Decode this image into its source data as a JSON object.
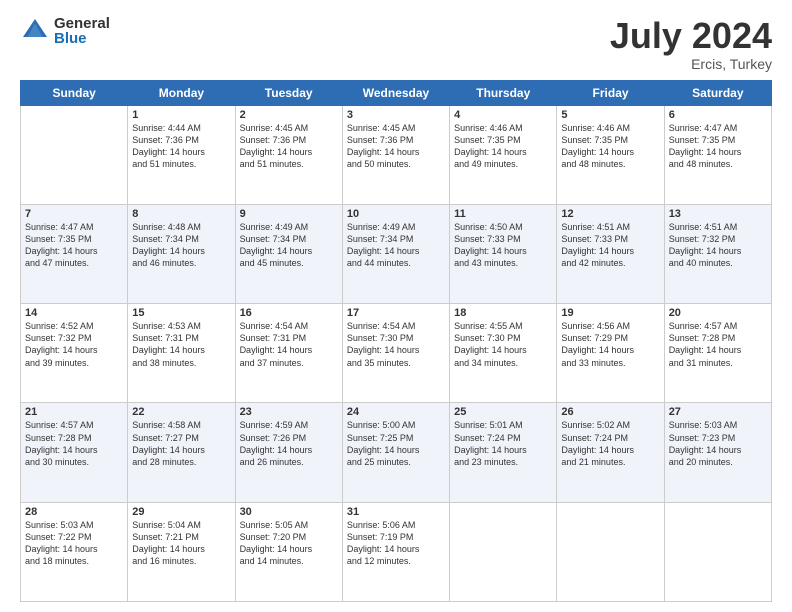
{
  "logo": {
    "general": "General",
    "blue": "Blue"
  },
  "title": "July 2024",
  "subtitle": "Ercis, Turkey",
  "days_of_week": [
    "Sunday",
    "Monday",
    "Tuesday",
    "Wednesday",
    "Thursday",
    "Friday",
    "Saturday"
  ],
  "weeks": [
    [
      {
        "day": "",
        "info": ""
      },
      {
        "day": "1",
        "info": "Sunrise: 4:44 AM\nSunset: 7:36 PM\nDaylight: 14 hours\nand 51 minutes."
      },
      {
        "day": "2",
        "info": "Sunrise: 4:45 AM\nSunset: 7:36 PM\nDaylight: 14 hours\nand 51 minutes."
      },
      {
        "day": "3",
        "info": "Sunrise: 4:45 AM\nSunset: 7:36 PM\nDaylight: 14 hours\nand 50 minutes."
      },
      {
        "day": "4",
        "info": "Sunrise: 4:46 AM\nSunset: 7:35 PM\nDaylight: 14 hours\nand 49 minutes."
      },
      {
        "day": "5",
        "info": "Sunrise: 4:46 AM\nSunset: 7:35 PM\nDaylight: 14 hours\nand 48 minutes."
      },
      {
        "day": "6",
        "info": "Sunrise: 4:47 AM\nSunset: 7:35 PM\nDaylight: 14 hours\nand 48 minutes."
      }
    ],
    [
      {
        "day": "7",
        "info": "Sunrise: 4:47 AM\nSunset: 7:35 PM\nDaylight: 14 hours\nand 47 minutes."
      },
      {
        "day": "8",
        "info": "Sunrise: 4:48 AM\nSunset: 7:34 PM\nDaylight: 14 hours\nand 46 minutes."
      },
      {
        "day": "9",
        "info": "Sunrise: 4:49 AM\nSunset: 7:34 PM\nDaylight: 14 hours\nand 45 minutes."
      },
      {
        "day": "10",
        "info": "Sunrise: 4:49 AM\nSunset: 7:34 PM\nDaylight: 14 hours\nand 44 minutes."
      },
      {
        "day": "11",
        "info": "Sunrise: 4:50 AM\nSunset: 7:33 PM\nDaylight: 14 hours\nand 43 minutes."
      },
      {
        "day": "12",
        "info": "Sunrise: 4:51 AM\nSunset: 7:33 PM\nDaylight: 14 hours\nand 42 minutes."
      },
      {
        "day": "13",
        "info": "Sunrise: 4:51 AM\nSunset: 7:32 PM\nDaylight: 14 hours\nand 40 minutes."
      }
    ],
    [
      {
        "day": "14",
        "info": "Sunrise: 4:52 AM\nSunset: 7:32 PM\nDaylight: 14 hours\nand 39 minutes."
      },
      {
        "day": "15",
        "info": "Sunrise: 4:53 AM\nSunset: 7:31 PM\nDaylight: 14 hours\nand 38 minutes."
      },
      {
        "day": "16",
        "info": "Sunrise: 4:54 AM\nSunset: 7:31 PM\nDaylight: 14 hours\nand 37 minutes."
      },
      {
        "day": "17",
        "info": "Sunrise: 4:54 AM\nSunset: 7:30 PM\nDaylight: 14 hours\nand 35 minutes."
      },
      {
        "day": "18",
        "info": "Sunrise: 4:55 AM\nSunset: 7:30 PM\nDaylight: 14 hours\nand 34 minutes."
      },
      {
        "day": "19",
        "info": "Sunrise: 4:56 AM\nSunset: 7:29 PM\nDaylight: 14 hours\nand 33 minutes."
      },
      {
        "day": "20",
        "info": "Sunrise: 4:57 AM\nSunset: 7:28 PM\nDaylight: 14 hours\nand 31 minutes."
      }
    ],
    [
      {
        "day": "21",
        "info": "Sunrise: 4:57 AM\nSunset: 7:28 PM\nDaylight: 14 hours\nand 30 minutes."
      },
      {
        "day": "22",
        "info": "Sunrise: 4:58 AM\nSunset: 7:27 PM\nDaylight: 14 hours\nand 28 minutes."
      },
      {
        "day": "23",
        "info": "Sunrise: 4:59 AM\nSunset: 7:26 PM\nDaylight: 14 hours\nand 26 minutes."
      },
      {
        "day": "24",
        "info": "Sunrise: 5:00 AM\nSunset: 7:25 PM\nDaylight: 14 hours\nand 25 minutes."
      },
      {
        "day": "25",
        "info": "Sunrise: 5:01 AM\nSunset: 7:24 PM\nDaylight: 14 hours\nand 23 minutes."
      },
      {
        "day": "26",
        "info": "Sunrise: 5:02 AM\nSunset: 7:24 PM\nDaylight: 14 hours\nand 21 minutes."
      },
      {
        "day": "27",
        "info": "Sunrise: 5:03 AM\nSunset: 7:23 PM\nDaylight: 14 hours\nand 20 minutes."
      }
    ],
    [
      {
        "day": "28",
        "info": "Sunrise: 5:03 AM\nSunset: 7:22 PM\nDaylight: 14 hours\nand 18 minutes."
      },
      {
        "day": "29",
        "info": "Sunrise: 5:04 AM\nSunset: 7:21 PM\nDaylight: 14 hours\nand 16 minutes."
      },
      {
        "day": "30",
        "info": "Sunrise: 5:05 AM\nSunset: 7:20 PM\nDaylight: 14 hours\nand 14 minutes."
      },
      {
        "day": "31",
        "info": "Sunrise: 5:06 AM\nSunset: 7:19 PM\nDaylight: 14 hours\nand 12 minutes."
      },
      {
        "day": "",
        "info": ""
      },
      {
        "day": "",
        "info": ""
      },
      {
        "day": "",
        "info": ""
      }
    ]
  ]
}
